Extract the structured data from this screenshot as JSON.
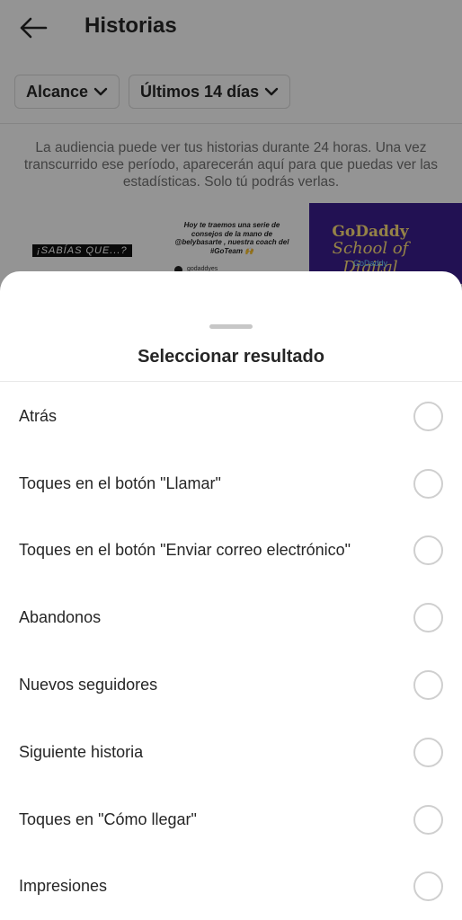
{
  "header": {
    "title": "Historias",
    "back_icon": "arrow-left-icon"
  },
  "filters": [
    {
      "label": "Alcance"
    },
    {
      "label": "Últimos 14 días"
    }
  ],
  "info_text": "La audiencia puede ver tus historias durante 24 horas. Una vez transcurrido ese período, aparecerán aquí para que puedas ver las estadísticas. Solo tú podrás verlas.",
  "thumbnails": {
    "t1_text": "¡SABÍAS QUE...?",
    "t2_text": "Hoy te traemos una serie de consejos de la mano de @belybasarte , nuestra coach del #GoTeam 🙌",
    "t2_brand": "godaddyes",
    "t3_title": "GoDaddy",
    "t3_subtitle": "School of Digital",
    "t3_logo": "GoDaddy"
  },
  "sheet": {
    "title": "Seleccionar resultado",
    "options": [
      {
        "label": "Atrás",
        "selected": false
      },
      {
        "label": "Toques en el botón \"Llamar\"",
        "selected": false
      },
      {
        "label": "Toques en el botón \"Enviar correo electrónico\"",
        "selected": false
      },
      {
        "label": "Abandonos",
        "selected": false
      },
      {
        "label": "Nuevos seguidores",
        "selected": false
      },
      {
        "label": "Siguiente historia",
        "selected": false
      },
      {
        "label": "Toques en \"Cómo llegar\"",
        "selected": false
      },
      {
        "label": "Impresiones",
        "selected": false
      }
    ]
  },
  "colors": {
    "text": "#262626",
    "muted": "#737373",
    "godaddy_bg": "#3b1e8f",
    "godaddy_text": "#ffe07a"
  }
}
